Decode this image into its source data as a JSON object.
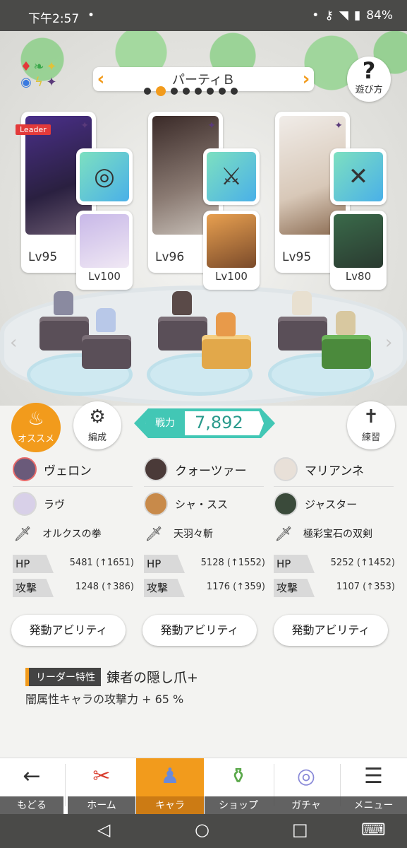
{
  "status_bar": {
    "time": "下午2:57",
    "dot": "•",
    "battery": "84%"
  },
  "party": {
    "name": "パーティＢ",
    "page_count": 8,
    "active_page": 2
  },
  "help": {
    "label": "遊び方"
  },
  "cards": [
    {
      "leader_badge": "Leader",
      "level": "Lv95",
      "sub_level": "Lv100",
      "weapon_icon": "brain-orb-icon"
    },
    {
      "leader_badge": "",
      "level": "Lv96",
      "sub_level": "Lv100",
      "weapon_icon": "sword-icon"
    },
    {
      "leader_badge": "",
      "level": "Lv95",
      "sub_level": "Lv80",
      "weapon_icon": "crossed-swords-icon"
    }
  ],
  "actions": {
    "recommend": "オススメ",
    "formation": "編成",
    "power_label": "戦力",
    "power_value": "7,892",
    "practice": "練習"
  },
  "columns": [
    {
      "main": "ヴェロン",
      "sub": "ラヴ",
      "weapon": "オルクスの拳",
      "hp": "5481 (↑1651)",
      "atk": "1248 (↑386)",
      "ability": "発動アビリティ"
    },
    {
      "main": "クォーツァー",
      "sub": "シャ・スス",
      "weapon": "天羽々斬",
      "hp": "5128 (↑1552)",
      "atk": "1176 (↑359)",
      "ability": "発動アビリティ"
    },
    {
      "main": "マリアンネ",
      "sub": "ジャスター",
      "weapon": "極彩宝石の双剣",
      "hp": "5252 (↑1452)",
      "atk": "1107 (↑353)",
      "ability": "発動アビリティ"
    }
  ],
  "stat_labels": {
    "hp": "HP",
    "atk": "攻撃"
  },
  "leader_skill": {
    "badge": "リーダー特性",
    "title": "錬者の隠し爪+",
    "desc": "闇属性キャラの攻撃力 + 65 %"
  },
  "bottom_nav": [
    {
      "label": "もどる",
      "icon": "back-arrow-icon"
    },
    {
      "label": "ホーム",
      "icon": "home-icon"
    },
    {
      "label": "キャラ",
      "icon": "character-icon"
    },
    {
      "label": "ショップ",
      "icon": "shop-icon"
    },
    {
      "label": "ガチャ",
      "icon": "gacha-icon"
    },
    {
      "label": "メニュー",
      "icon": "menu-icon"
    }
  ],
  "colors": {
    "accent": "#f29b1c",
    "teal": "#42c7b5"
  }
}
